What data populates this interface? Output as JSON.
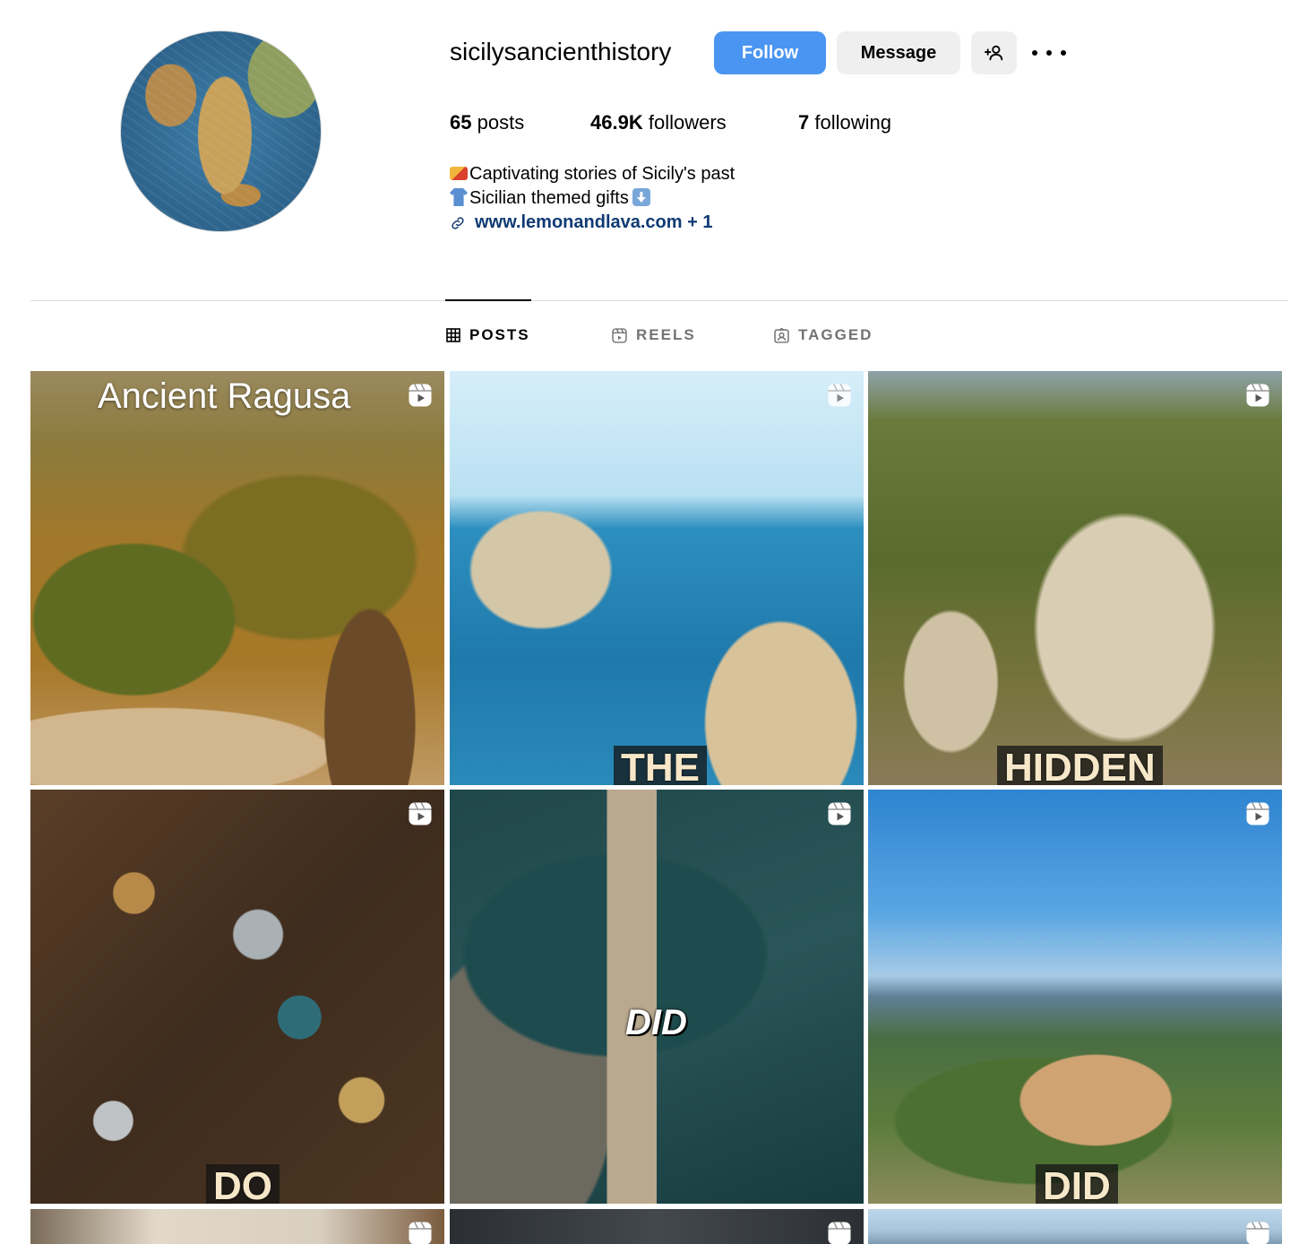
{
  "profile": {
    "username": "sicilysancienthistory",
    "follow_label": "Follow",
    "message_label": "Message",
    "add_user_icon": "add-user-icon",
    "more_icon": "more-options-icon"
  },
  "stats": {
    "posts_count": "65",
    "posts_label": "posts",
    "followers_count": "46.9K",
    "followers_label": "followers",
    "following_count": "7",
    "following_label": "following"
  },
  "bio": {
    "line1": "Captivating stories of Sicily's past",
    "line2": "Sicilian themed gifts",
    "link": "www.lemonandlava.com + 1"
  },
  "tabs": [
    {
      "label": "POSTS",
      "active": true,
      "icon": "grid-icon"
    },
    {
      "label": "REELS",
      "active": false,
      "icon": "reels-icon"
    },
    {
      "label": "TAGGED",
      "active": false,
      "icon": "tagged-icon"
    }
  ],
  "posts": [
    {
      "caption": "Ancient Ragusa",
      "type": "reel"
    },
    {
      "caption": "THE",
      "type": "reel"
    },
    {
      "caption": "HIDDEN",
      "type": "reel"
    },
    {
      "caption": "DO",
      "type": "reel"
    },
    {
      "caption": "DID",
      "type": "reel"
    },
    {
      "caption": "DID",
      "type": "reel"
    },
    {
      "caption": "",
      "type": "reel"
    },
    {
      "caption": "",
      "type": "reel"
    },
    {
      "caption": "",
      "type": "reel"
    }
  ],
  "colors": {
    "follow_button": "#4a95f1",
    "secondary_button": "#efefef",
    "link": "#0f3a73",
    "muted_tab": "#737373",
    "divider": "#dbdbdb"
  }
}
